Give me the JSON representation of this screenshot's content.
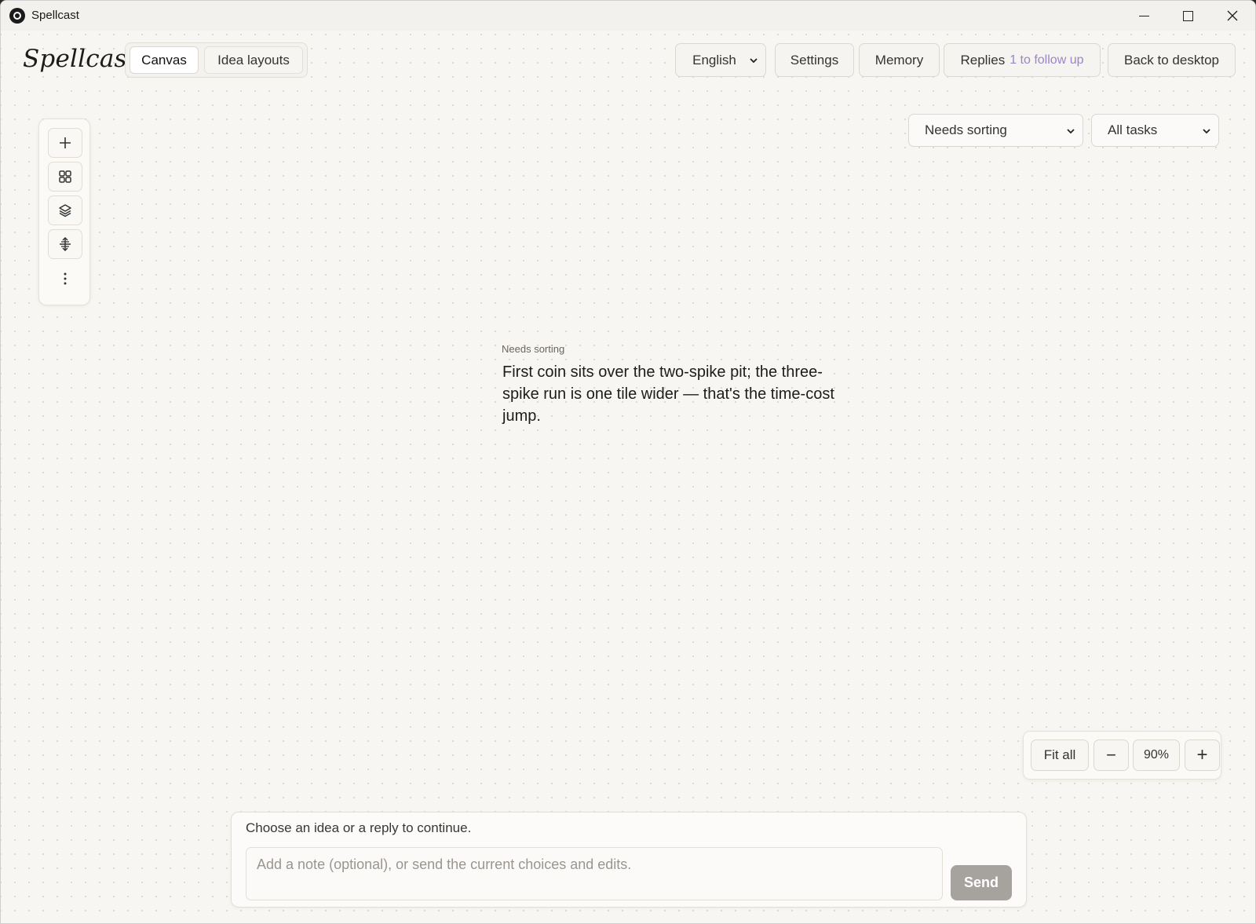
{
  "window": {
    "title": "Spellcast",
    "controls": {
      "minimize": "minimize-icon",
      "maximize": "maximize-icon",
      "close": "close-icon"
    }
  },
  "header": {
    "brand": "Spellcast",
    "tabs": [
      {
        "label": "Canvas",
        "active": true
      },
      {
        "label": "Idea layouts",
        "active": false
      }
    ],
    "language": "English",
    "settings_label": "Settings",
    "memory_label": "Memory",
    "replies_label": "Replies",
    "replies_followup": "1 to follow up",
    "back_label": "Back to desktop"
  },
  "filters": {
    "status": "Needs sorting",
    "tasks": "All tasks"
  },
  "toolbar": {
    "tools": [
      "add-icon",
      "grid-icon",
      "layers-icon",
      "align-icon",
      "more-icon"
    ]
  },
  "note": {
    "tag": "Needs sorting",
    "text": "First coin sits over the two-spike pit; the three-spike run is one tile wider — that's the time-cost jump."
  },
  "zoom": {
    "fit_label": "Fit all",
    "minus": "−",
    "level": "90%",
    "plus": "+"
  },
  "composer": {
    "prompt": "Choose an idea or a reply to continue.",
    "placeholder": "Add a note (optional), or send the current choices and edits.",
    "value": "",
    "send_label": "Send"
  },
  "colors": {
    "accent_purple": "#9b85c9",
    "send_disabled": "#a6a39f",
    "background": "#f8f6f2"
  }
}
